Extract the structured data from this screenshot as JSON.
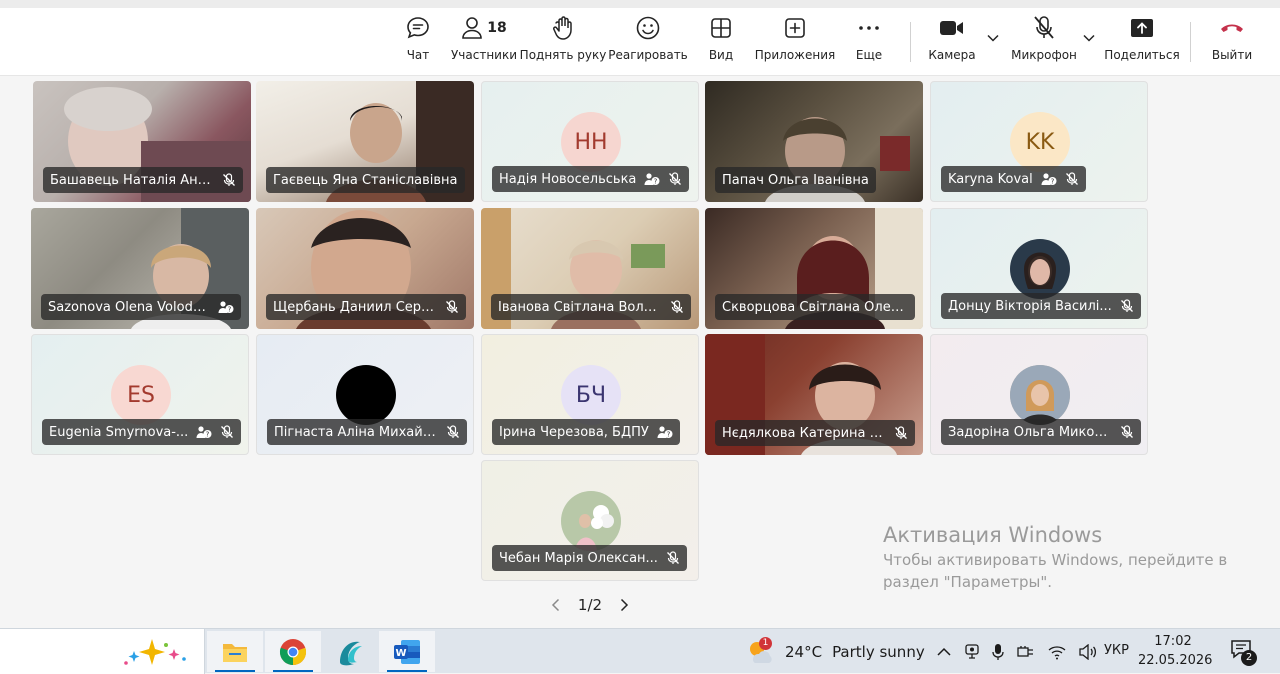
{
  "toolbar": {
    "chat": "Чат",
    "participants": "Участники",
    "participants_count": "18",
    "raise_hand": "Поднять руку",
    "react": "Реагировать",
    "view": "Вид",
    "apps": "Приложения",
    "more": "Еще",
    "camera": "Камера",
    "mic": "Микрофон",
    "share": "Поделиться",
    "leave": "Выйти",
    "colors": {
      "leave": "#c4314b",
      "text": "#242424"
    }
  },
  "tiles": [
    {
      "name": "Башавець Наталія Анд...",
      "kind": "video",
      "muted": true
    },
    {
      "name": "Гаєвець Яна Станіславівна",
      "kind": "video",
      "muted": false
    },
    {
      "name": "Надія Новосельська",
      "kind": "avatar",
      "initials": "НН",
      "muted": true,
      "status": "unknown"
    },
    {
      "name": "Папач Ольга Іванівна",
      "kind": "video",
      "muted": false
    },
    {
      "name": "Karyna Koval",
      "kind": "avatar",
      "initials": "KK",
      "muted": true,
      "status": "unknown"
    },
    {
      "name": "Sazonova Olena Volody...",
      "kind": "video",
      "muted": false,
      "status": "unknown"
    },
    {
      "name": "Щербань Даниил Серг...",
      "kind": "video",
      "muted": true
    },
    {
      "name": "Іванова Світлана Воло...",
      "kind": "video",
      "muted": true
    },
    {
      "name": "Скворцова Світлана Олекс...",
      "kind": "video",
      "muted": false
    },
    {
      "name": "Донцу Вікторія Василі...",
      "kind": "photo",
      "muted": true
    },
    {
      "name": "Eugenia Smyrnova-...",
      "kind": "avatar",
      "initials": "ES",
      "muted": true,
      "status": "unknown"
    },
    {
      "name": "Пігнаста Аліна Михайл...",
      "kind": "photo",
      "muted": true
    },
    {
      "name": "Ірина Черезова, БДПУ",
      "kind": "avatar",
      "initials": "БЧ",
      "muted": false,
      "status": "unknown"
    },
    {
      "name": "Нєдялкова Катерина В...",
      "kind": "video",
      "muted": true
    },
    {
      "name": "Задоріна Ольга Микол...",
      "kind": "photo",
      "muted": true
    },
    {
      "name": "Чебан Марія Олексан...",
      "kind": "photo",
      "muted": true
    }
  ],
  "pager": {
    "label": "1/2"
  },
  "watermark": {
    "title": "Активация Windows",
    "line1": "Чтобы активировать Windows, перейдите в",
    "line2": "раздел \"Параметры\"."
  },
  "taskbar": {
    "apps": [
      "file-explorer",
      "chrome",
      "edge-like-app",
      "word"
    ],
    "weather_temp": "24°C",
    "weather_text": "Partly sunny",
    "weather_badge": "1",
    "lang": "УКР",
    "time": "17:02",
    "date": "22.05.2026",
    "notif_count": "2"
  }
}
